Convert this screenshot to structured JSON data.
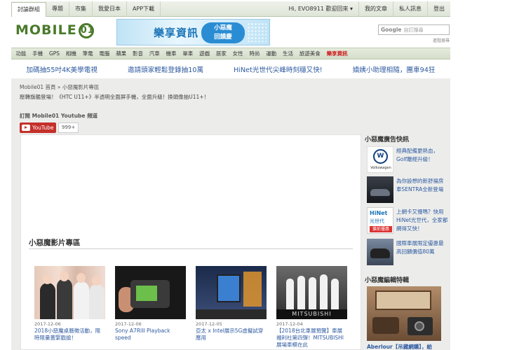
{
  "topbar": {
    "tabs": [
      "討論群組",
      "專題",
      "市集",
      "我愛日本",
      "APP下載"
    ],
    "greeting": "Hi, EVO8911 歡迎回來 ▾",
    "right_links": [
      "我的文章",
      "私人訊息",
      "登出"
    ]
  },
  "header": {
    "logo_text": "MOBILE",
    "logo_suffix": "01",
    "banner_left": "樂享資訊",
    "banner_right_line1": "小惡魔",
    "banner_right_line2": "回饋慶",
    "search_brand": "Google",
    "search_placeholder": "自訂搜尋",
    "search_hint": "進階搜尋"
  },
  "categories": [
    "功能",
    "手機",
    "GPS",
    "相機",
    "筆電",
    "電腦",
    "蘋果",
    "影音",
    "汽車",
    "機車",
    "單車",
    "遊戲",
    "居家",
    "女性",
    "時尚",
    "運動",
    "生活",
    "旅遊美食",
    "樂享資訊"
  ],
  "promos": [
    "加碼抽55吋4K美學電視",
    "邀請頭家輕鬆登錄抽10萬",
    "HiNet光世代尖峰時刻穩又快!",
    "嬌姨小助理相隨，團車94狂"
  ],
  "content": {
    "breadcrumb": "Mobile01 首頁 » 小惡魔影片專區",
    "subtext": "壓轉旗艦登場！《HTC U11+》半透明全面屏手機，全面升級！換頭像抽U11+！",
    "subscribe_label": "訂閱 Mobile01 Youtube 頻道",
    "youtube_label": "YouTube",
    "youtube_count": "999+",
    "section_title": "小惡魔影片專區",
    "videos": [
      {
        "date": "2017-12-06",
        "title": "2018小惡魔桌曆徵活動，限時限量蓋緊戳搶！"
      },
      {
        "date": "2017-12-06",
        "title": "Sony A7RIII Playback speed"
      },
      {
        "date": "2017-12-05",
        "title": "亞太 x Intel展示5G虛擬試穿應用"
      },
      {
        "date": "2017-12-04",
        "title": "【2018台北車展預覽】車展福利社第四彈！MITSUBISHI展場車模在此"
      }
    ],
    "thumb4_text": "MITSUBISHI"
  },
  "sidebar": {
    "title": "小惡魔廣告快訊",
    "ads": [
      {
        "icon_text": "W",
        "icon_name": "Volkswagen",
        "text": "經典配備更熱血，Golf離經升級！"
      },
      {
        "text": "為你設想的新舒揚房車SENTRA全新登場"
      },
      {
        "brand": "HiNet",
        "brand2": "光世代",
        "badge": "搶前優惠",
        "text": "上網卡又慢嗎？快用HiNet光世代，全家都網得又快！"
      },
      {
        "text": "國際車展限定優惠最高回饋價值80萬"
      }
    ],
    "feature_title": "小惡魔編輯特輯",
    "feature_caption": "Aberlour【吊藏網購】，給"
  }
}
